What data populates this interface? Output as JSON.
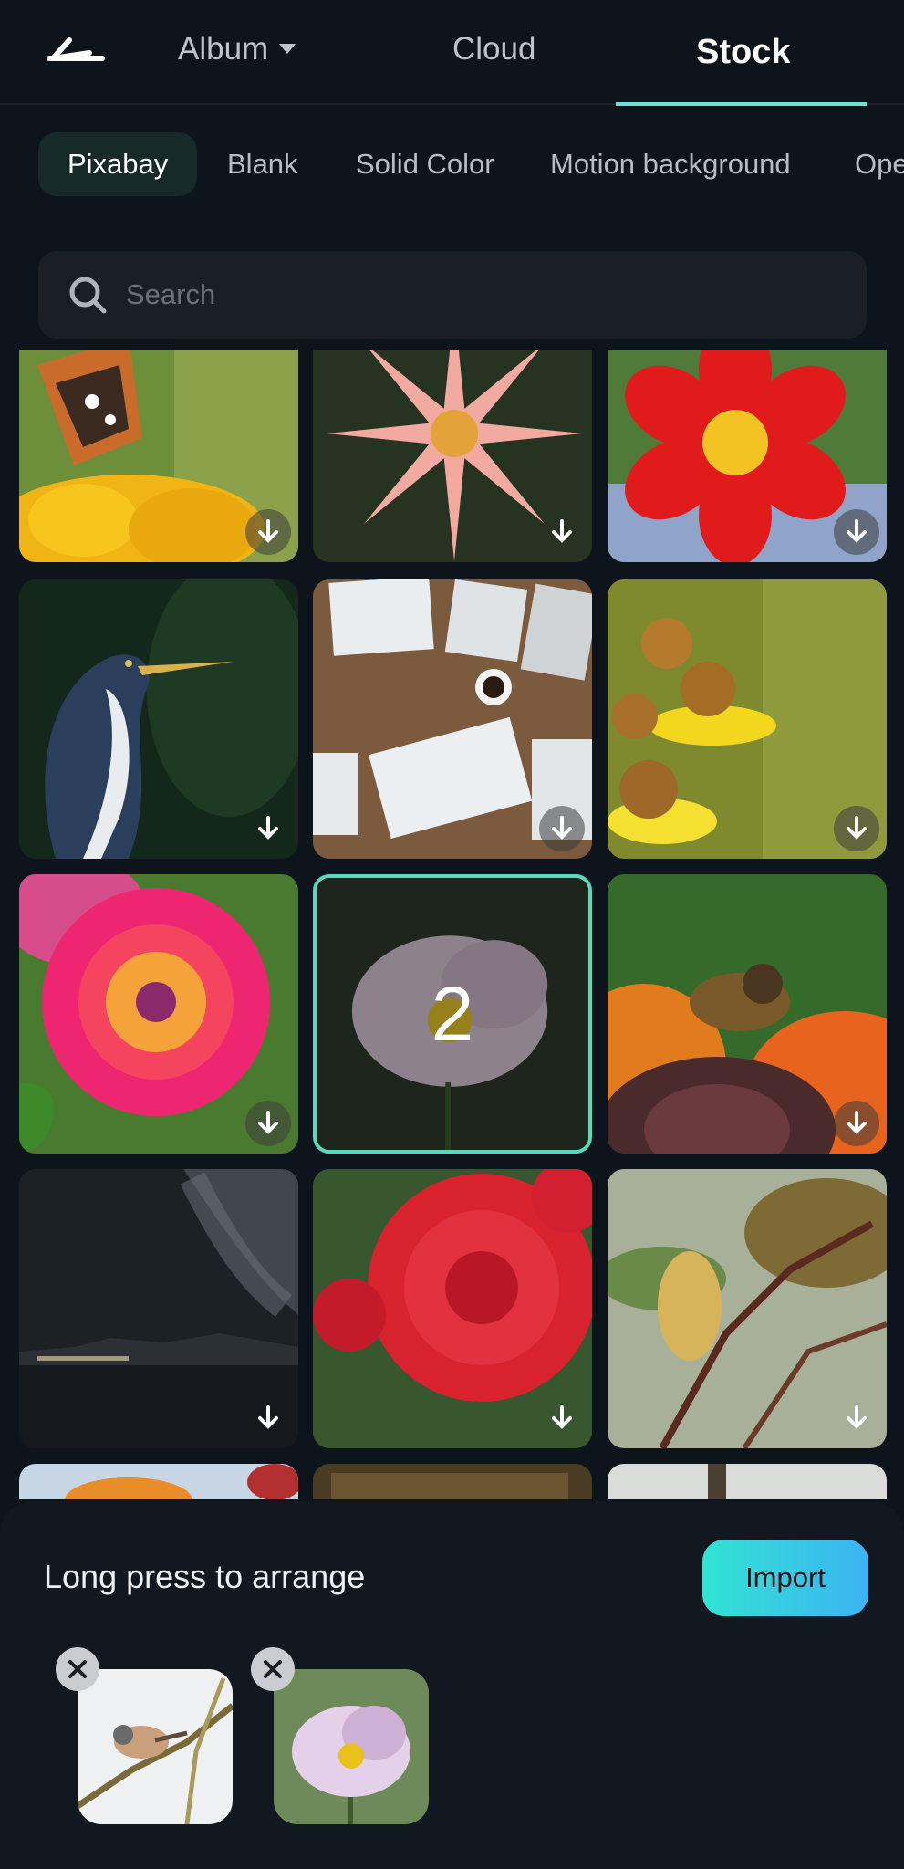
{
  "header": {
    "back_icon": "back-arrow-icon",
    "tabs": [
      {
        "label": "Album",
        "has_dropdown": true,
        "active": false
      },
      {
        "label": "Cloud",
        "active": false
      },
      {
        "label": "Stock",
        "active": true
      }
    ]
  },
  "categories": [
    {
      "label": "Pixabay",
      "active": true
    },
    {
      "label": "Blank"
    },
    {
      "label": "Solid Color"
    },
    {
      "label": "Motion background"
    },
    {
      "label": "Ope"
    }
  ],
  "search": {
    "placeholder": "Search",
    "icon": "search-icon"
  },
  "grid": {
    "download_icon": "download-arrow-icon",
    "items": [
      {
        "subject": "butterfly-on-yellow-flower",
        "downloadable": true
      },
      {
        "subject": "pink-star-flower",
        "downloadable": true
      },
      {
        "subject": "red-dahlia",
        "downloadable": true
      },
      {
        "subject": "heron",
        "downloadable": true
      },
      {
        "subject": "desk-with-papers",
        "downloadable": true
      },
      {
        "subject": "yellow-helenium-flowers",
        "downloadable": true
      },
      {
        "subject": "pink-orange-dahlia",
        "downloadable": true
      },
      {
        "subject": "white-cosmos-flower",
        "selected": true,
        "selection_number": "2"
      },
      {
        "subject": "bee-on-flower",
        "downloadable": true
      },
      {
        "subject": "night-sky-lake",
        "downloadable": true
      },
      {
        "subject": "red-dahlia-closeup",
        "downloadable": true
      },
      {
        "subject": "magnolia-bud",
        "downloadable": true
      }
    ]
  },
  "sheet": {
    "hint": "Long press to arrange",
    "import_label": "Import",
    "selected": [
      {
        "subject": "bird-on-branch"
      },
      {
        "subject": "white-cosmos-flower"
      }
    ],
    "remove_icon": "close-icon"
  },
  "colors": {
    "background": "#0e141b",
    "accent": "#6be3cf",
    "import_gradient_start": "#32e3d3",
    "import_gradient_end": "#3cb3f2"
  }
}
